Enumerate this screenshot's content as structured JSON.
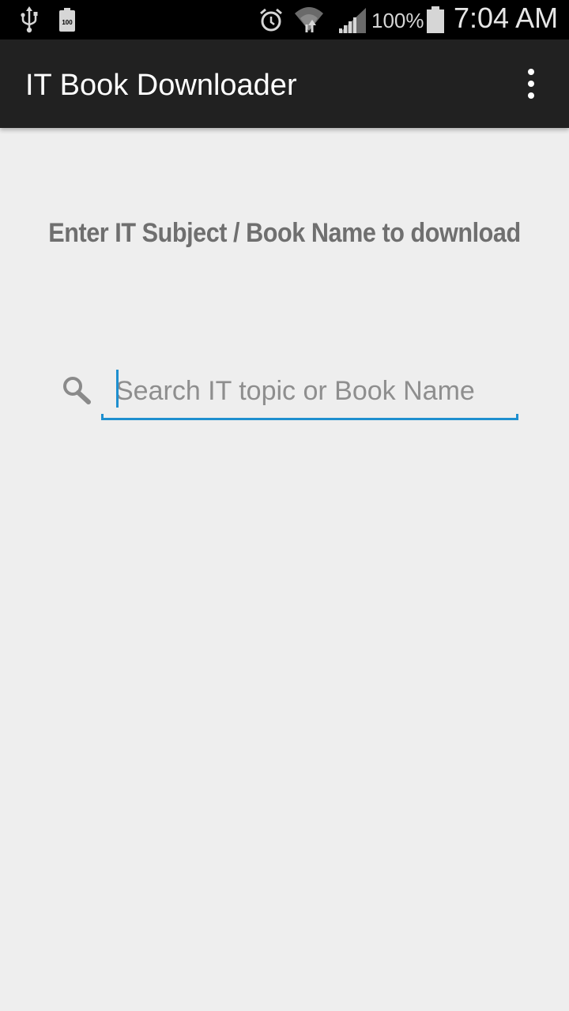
{
  "status_bar": {
    "battery_percent": "100%",
    "time": "7:04 AM",
    "battery_notification": "100",
    "icons": [
      "usb-icon",
      "battery-notification-icon",
      "alarm-icon",
      "wifi-icon",
      "signal-icon",
      "battery-icon"
    ]
  },
  "app_bar": {
    "title": "IT Book Downloader",
    "overflow_icon": "more-vert-icon"
  },
  "main": {
    "heading": "Enter IT Subject / Book Name to download",
    "search": {
      "placeholder": "Search IT topic or Book Name",
      "value": "",
      "icon": "search-icon"
    }
  },
  "colors": {
    "status_bar_bg": "#000000",
    "app_bar_bg": "#212121",
    "page_bg": "#eeeeee",
    "accent": "#1e8fcf",
    "heading_text": "#6f6f6f"
  }
}
